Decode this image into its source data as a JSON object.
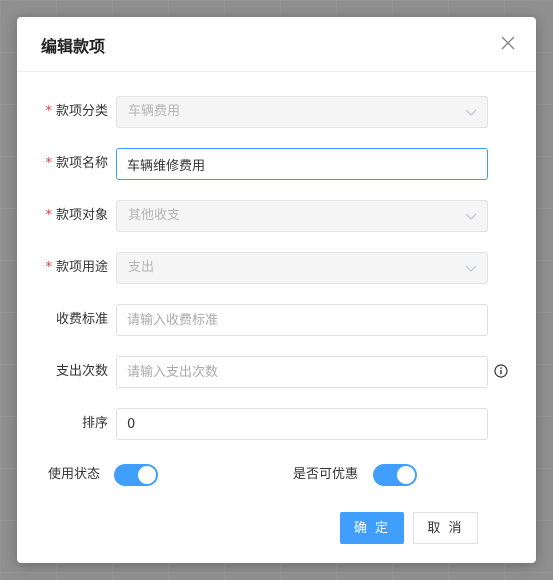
{
  "dialog": {
    "title": "编辑款项",
    "close_icon": "close-icon"
  },
  "form": {
    "required_mark": "*",
    "category": {
      "label": "款项分类",
      "value": "车辆费用",
      "disabled": true
    },
    "name": {
      "label": "款项名称",
      "value": "车辆维修费用"
    },
    "target": {
      "label": "款项对象",
      "value": "其他收支",
      "disabled": true
    },
    "usage": {
      "label": "款项用途",
      "value": "支出",
      "disabled": true
    },
    "charge_standard": {
      "label": "收费标准",
      "placeholder": "请输入收费标准",
      "value": ""
    },
    "expense_count": {
      "label": "支出次数",
      "placeholder": "请输入支出次数",
      "value": "",
      "info_icon": "info-circle-icon"
    },
    "sort": {
      "label": "排序",
      "value": "0"
    },
    "status": {
      "label": "使用状态",
      "on": true
    },
    "discountable": {
      "label": "是否可优惠",
      "on": true
    }
  },
  "buttons": {
    "confirm": "确 定",
    "cancel": "取 消"
  },
  "colors": {
    "accent": "#409eff",
    "required": "#e0373d",
    "disabled_bg": "#f5f5f5"
  }
}
